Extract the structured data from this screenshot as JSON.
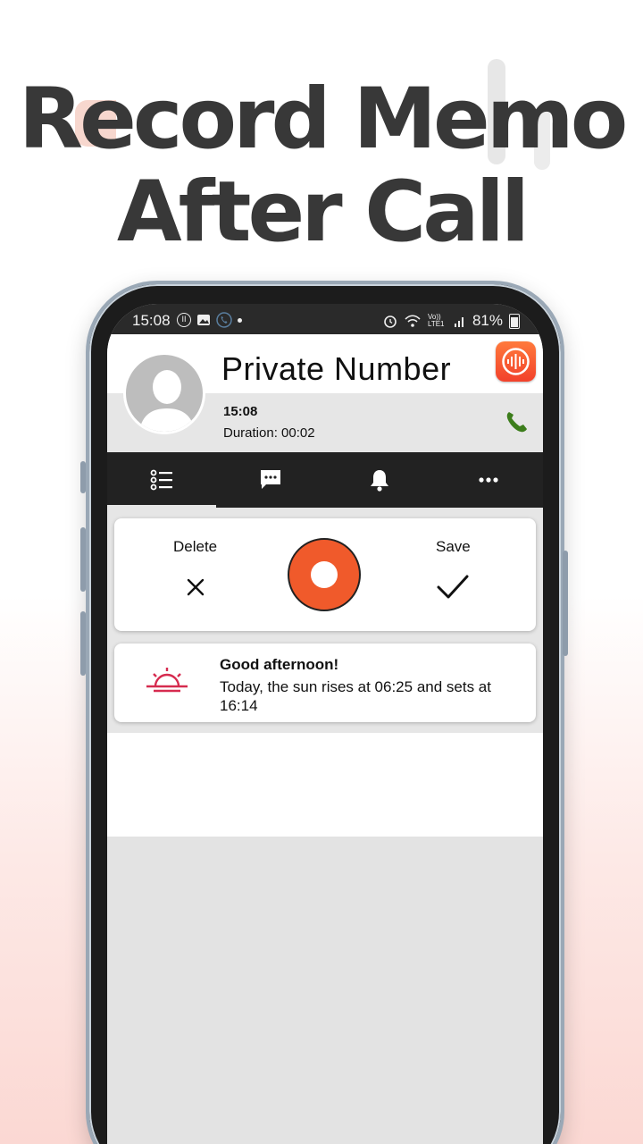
{
  "headline": {
    "line1": "Record Memo",
    "line2": "After Call"
  },
  "status_bar": {
    "time": "15:08",
    "battery": "81%",
    "network": "Vo)) LTE1"
  },
  "caller": {
    "name": "Private Number",
    "call_time": "15:08",
    "duration": "Duration: 00:02"
  },
  "tabs": [
    {
      "icon": "list-icon",
      "active": true
    },
    {
      "icon": "message-icon",
      "active": false
    },
    {
      "icon": "bell-icon",
      "active": false
    },
    {
      "icon": "more-icon",
      "active": false
    }
  ],
  "recorder": {
    "delete_label": "Delete",
    "save_label": "Save"
  },
  "info": {
    "title": "Good afternoon!",
    "text": "Today, the sun rises at 06:25 and sets at 16:14"
  },
  "colors": {
    "record_accent": "#f05a2b",
    "sunrise_icon": "#d62b4f",
    "call_icon": "#3c7d1b",
    "tabbar": "#222222"
  }
}
